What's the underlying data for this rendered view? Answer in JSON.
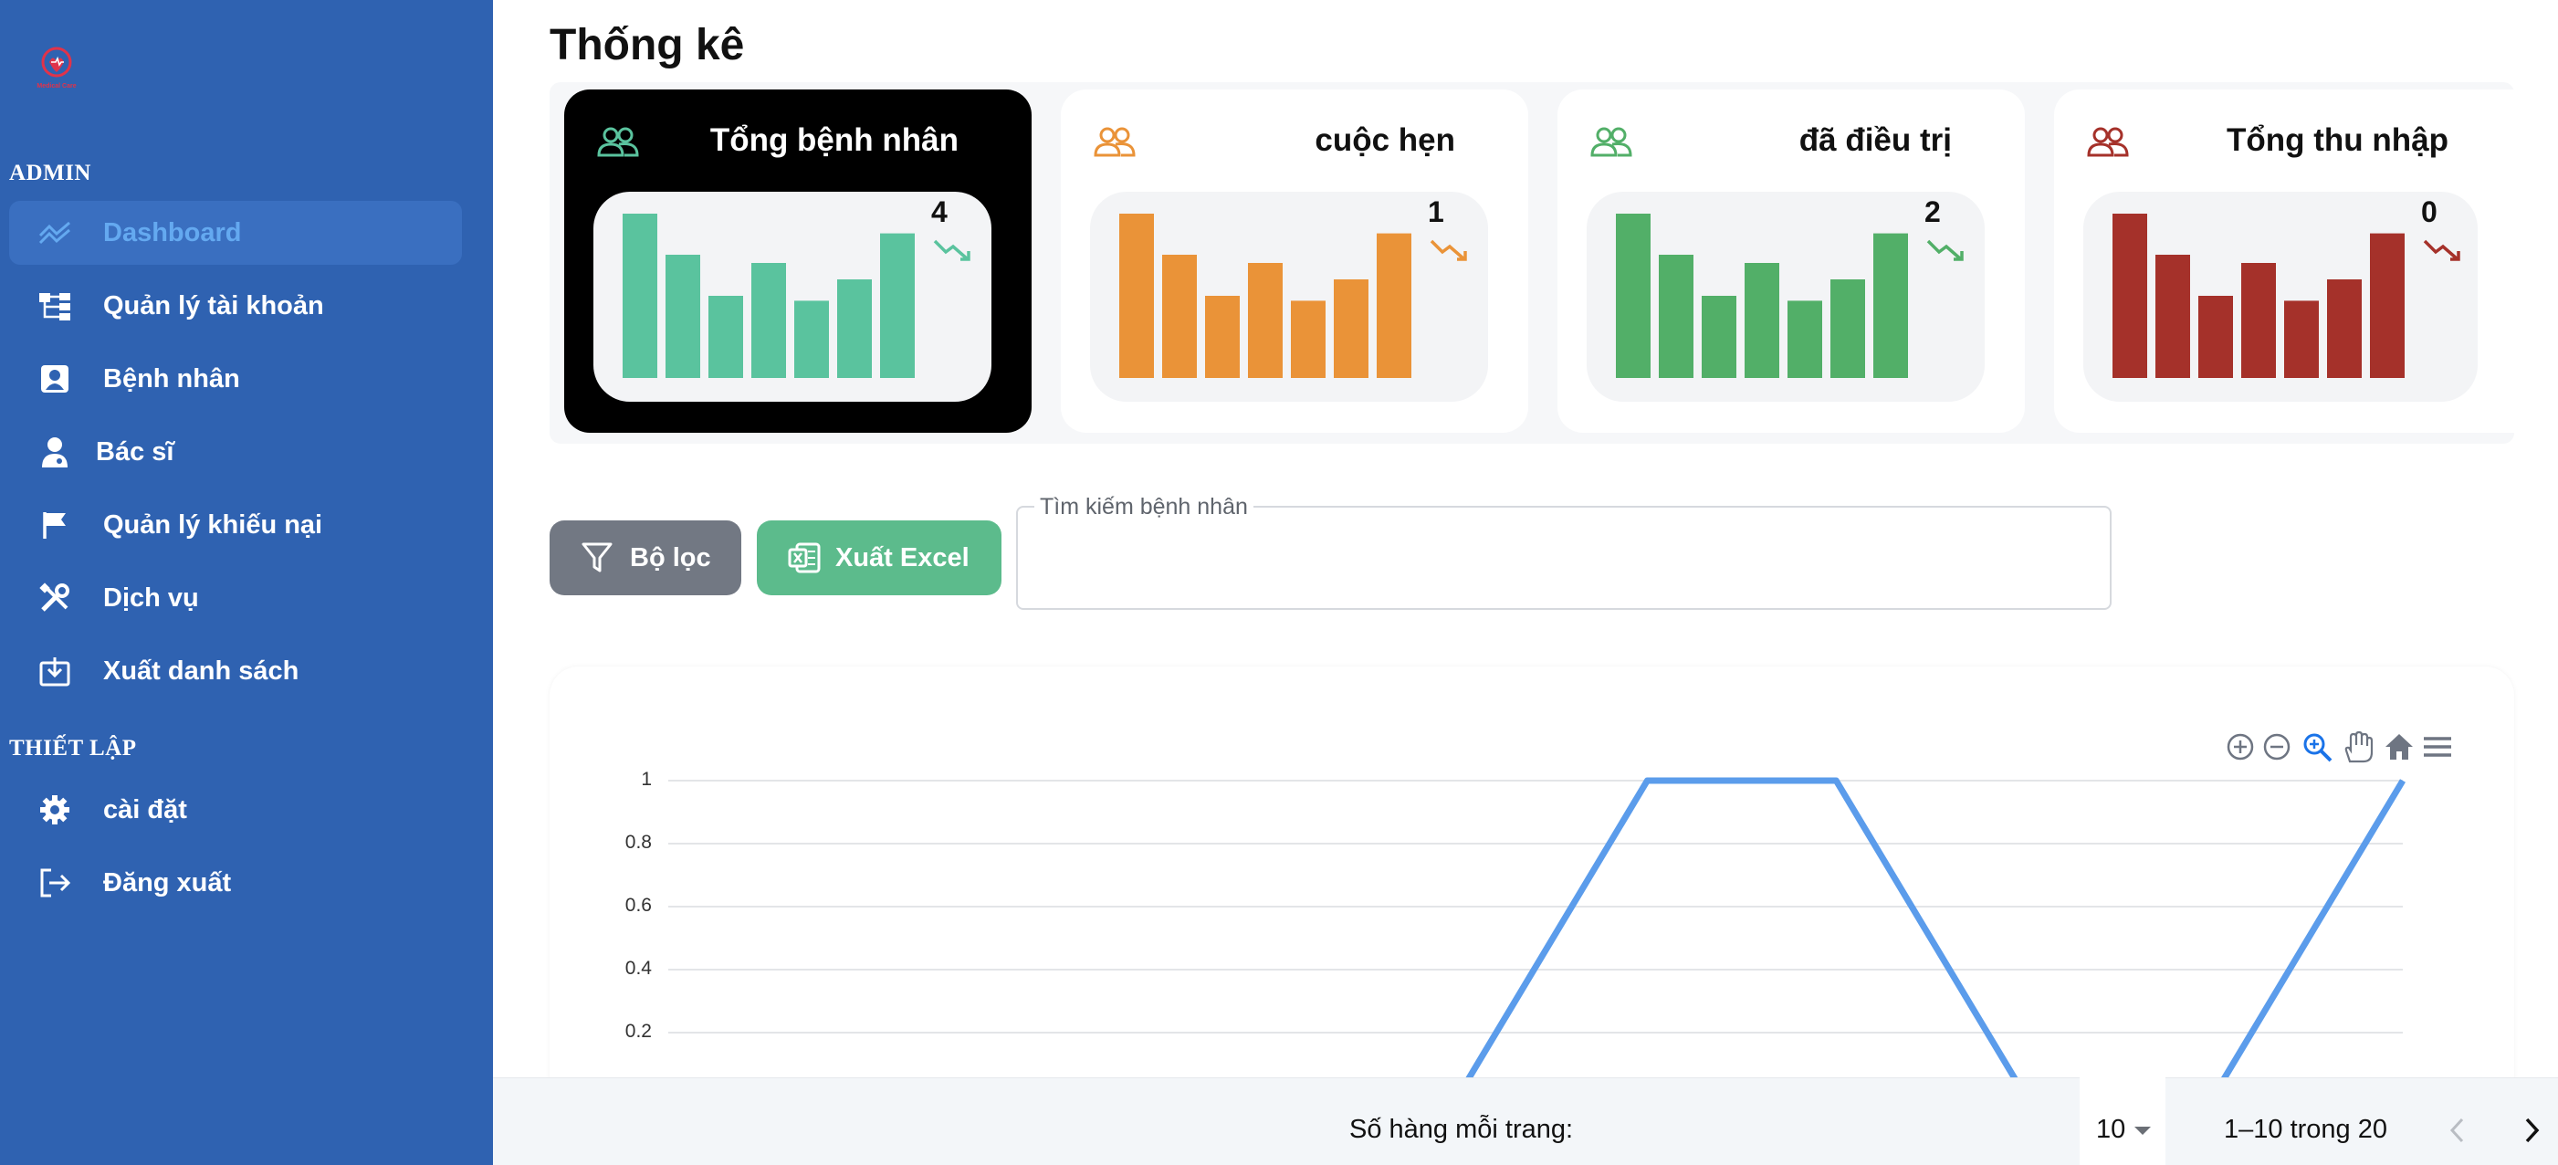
{
  "sidebar": {
    "logo_text": "Medical Care",
    "section_admin": "ADMIN",
    "section_settings": "THIẾT LẬP",
    "items": [
      {
        "label": "Dashboard",
        "icon": "chart-line-icon",
        "active": true
      },
      {
        "label": "Quản lý tài khoản",
        "icon": "sitemap-icon"
      },
      {
        "label": "Bệnh nhân",
        "icon": "patient-card-icon"
      },
      {
        "label": "Bác sĩ",
        "icon": "doctor-icon"
      },
      {
        "label": "Quản lý khiếu nại",
        "icon": "flag-icon"
      },
      {
        "label": "Dịch vụ",
        "icon": "tools-icon"
      },
      {
        "label": "Xuất danh sách",
        "icon": "download-icon"
      }
    ],
    "settings_items": [
      {
        "label": "cài đặt",
        "icon": "gear-icon"
      },
      {
        "label": "Đăng xuất",
        "icon": "logout-icon"
      }
    ]
  },
  "main": {
    "title": "Thống kê",
    "cards": [
      {
        "title": "Tổng bệnh nhân",
        "count": "4",
        "color": "#5ac39e",
        "trend_icon": "trend-down-icon",
        "dark": true
      },
      {
        "title": "cuộc hẹn",
        "count": "1",
        "color": "#ea9338",
        "trend_icon": "trend-down-icon",
        "dark": false
      },
      {
        "title": "đã điều trị",
        "count": "2",
        "color": "#52af68",
        "trend_icon": "trend-down-icon",
        "dark": false
      },
      {
        "title": "Tổng thu nhập",
        "count": "0",
        "color": "#a5312a",
        "trend_icon": "trend-down-icon",
        "dark": false
      }
    ],
    "card_bar_levels": [
      1.0,
      0.75,
      0.5,
      0.7,
      0.47,
      0.6,
      0.88
    ],
    "filter_button": "Bộ lọc",
    "excel_button": "Xuất Excel",
    "search": {
      "label": "Tìm kiếm bệnh nhân",
      "value": "",
      "placeholder": ""
    }
  },
  "chart_data": {
    "type": "line",
    "title": "",
    "xlabel": "",
    "ylabel": "",
    "ylim": [
      0,
      1
    ],
    "yticks": [
      "1",
      "0.8",
      "0.6",
      "0.4",
      "0.2"
    ],
    "grid": true,
    "series": [
      {
        "values": [
          0,
          0,
          0,
          0,
          0,
          1,
          1,
          0,
          0,
          1
        ]
      }
    ],
    "color": "#5b9ceb",
    "toolbar": [
      "zoom-in-icon",
      "zoom-out-icon",
      "zoom-select-icon",
      "pan-hand-icon",
      "home-reset-icon",
      "menu-icon"
    ]
  },
  "footer": {
    "rows_per_page_label": "Số hàng mỗi trang:",
    "rows_per_page_value": "10",
    "range_text": "1–10 trong 20"
  }
}
